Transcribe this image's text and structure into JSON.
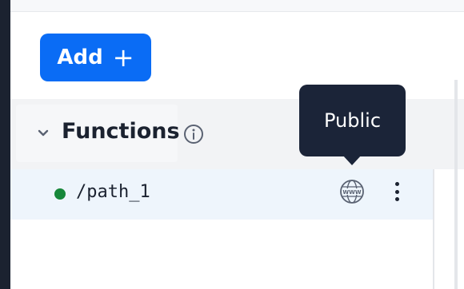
{
  "toolbar": {
    "add_label": "Add",
    "add_icon": "plus-icon"
  },
  "section": {
    "title": "Functions",
    "collapse_icon": "chevron-down-icon",
    "info_icon": "info-icon",
    "expanded": true
  },
  "functions": [
    {
      "path": "/path_1",
      "status_color": "#16873a",
      "visibility_icon": "globe-www-icon",
      "menu_icon": "kebab-menu-icon"
    }
  ],
  "tooltip": {
    "text": "Public"
  },
  "colors": {
    "primary": "#0a6cf5",
    "dark": "#1b2230",
    "tooltip_bg": "#1b2438",
    "row_highlight": "#eef5fc",
    "status_ok": "#16873a"
  }
}
